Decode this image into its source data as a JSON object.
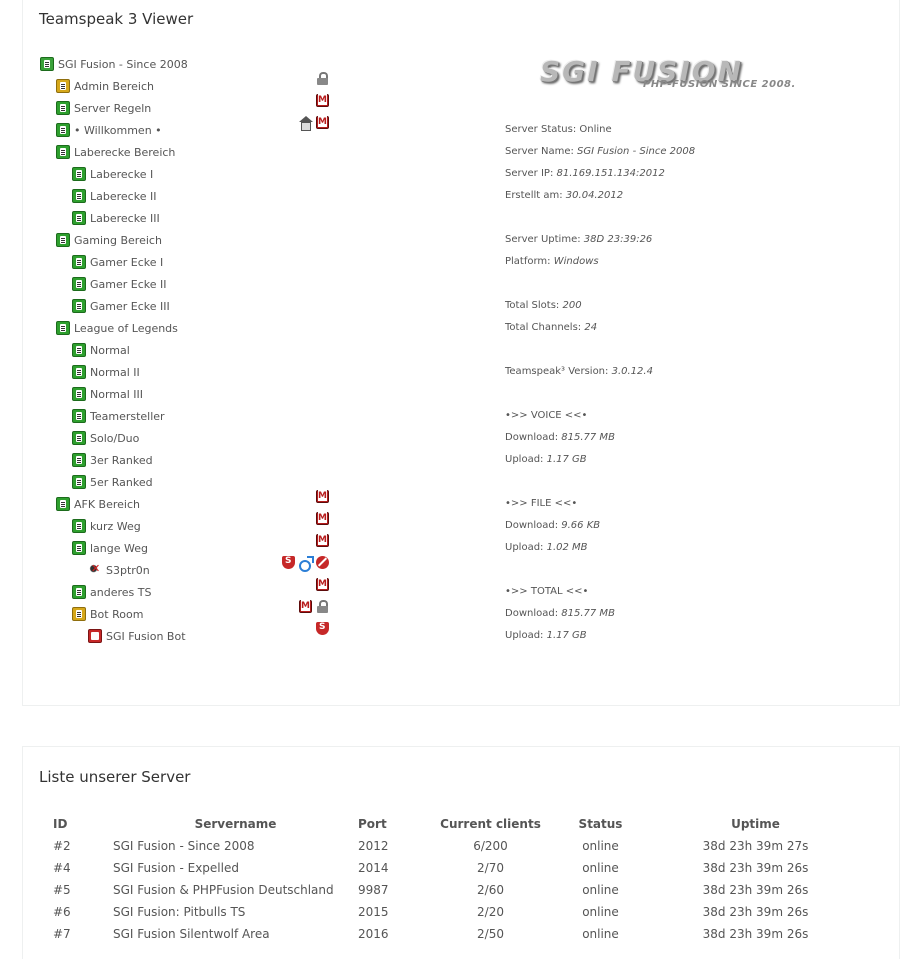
{
  "viewer": {
    "title": "Teamspeak 3 Viewer",
    "logo": {
      "main": "SGI FUSION",
      "sub": "PHP-FUSION SINCE 2008."
    },
    "tree": [
      {
        "label": "SGI Fusion - Since 2008",
        "type": "server",
        "depth": 0,
        "flags": []
      },
      {
        "label": "Admin Bereich",
        "type": "channel-locked",
        "depth": 1,
        "flags": [
          "lock"
        ]
      },
      {
        "label": "Server Regeln",
        "type": "channel",
        "depth": 1,
        "flags": [
          "moderated"
        ]
      },
      {
        "label": "• Willkommen •",
        "type": "channel",
        "depth": 1,
        "flags": [
          "home",
          "moderated"
        ]
      },
      {
        "label": "Laberecke Bereich",
        "type": "channel",
        "depth": 1,
        "flags": []
      },
      {
        "label": "Laberecke I",
        "type": "channel",
        "depth": 2,
        "flags": []
      },
      {
        "label": "Laberecke II",
        "type": "channel",
        "depth": 2,
        "flags": []
      },
      {
        "label": "Laberecke III",
        "type": "channel",
        "depth": 2,
        "flags": []
      },
      {
        "label": "Gaming Bereich",
        "type": "channel",
        "depth": 1,
        "flags": []
      },
      {
        "label": "Gamer Ecke I",
        "type": "channel",
        "depth": 2,
        "flags": []
      },
      {
        "label": "Gamer Ecke II",
        "type": "channel",
        "depth": 2,
        "flags": []
      },
      {
        "label": "Gamer Ecke III",
        "type": "channel",
        "depth": 2,
        "flags": []
      },
      {
        "label": "League of Legends",
        "type": "channel",
        "depth": 1,
        "flags": []
      },
      {
        "label": "Normal",
        "type": "channel",
        "depth": 2,
        "flags": []
      },
      {
        "label": "Normal II",
        "type": "channel",
        "depth": 2,
        "flags": []
      },
      {
        "label": "Normal III",
        "type": "channel",
        "depth": 2,
        "flags": []
      },
      {
        "label": "Teamersteller",
        "type": "channel",
        "depth": 2,
        "flags": []
      },
      {
        "label": "Solo/Duo",
        "type": "channel",
        "depth": 2,
        "flags": []
      },
      {
        "label": "3er Ranked",
        "type": "channel",
        "depth": 2,
        "flags": []
      },
      {
        "label": "5er Ranked",
        "type": "channel",
        "depth": 2,
        "flags": []
      },
      {
        "label": "AFK Bereich",
        "type": "channel",
        "depth": 1,
        "flags": [
          "moderated"
        ]
      },
      {
        "label": "kurz Weg",
        "type": "channel",
        "depth": 2,
        "flags": [
          "moderated"
        ]
      },
      {
        "label": "lange Weg",
        "type": "channel",
        "depth": 2,
        "flags": [
          "moderated"
        ]
      },
      {
        "label": "S3ptr0n",
        "type": "user-muted",
        "depth": 3,
        "flags": [
          "shield",
          "gender",
          "no-audio"
        ]
      },
      {
        "label": "anderes TS",
        "type": "channel",
        "depth": 2,
        "flags": [
          "moderated"
        ]
      },
      {
        "label": "Bot Room",
        "type": "channel-locked",
        "depth": 2,
        "flags": [
          "moderated",
          "lock"
        ]
      },
      {
        "label": "SGI Fusion Bot",
        "type": "user-bot",
        "depth": 3,
        "flags": [
          "shield"
        ]
      }
    ],
    "info": [
      {
        "row": 3,
        "label": "Server Status: Online",
        "value": ""
      },
      {
        "row": 4,
        "label": "Server Name: ",
        "value": "SGI Fusion - Since 2008"
      },
      {
        "row": 5,
        "label": "Server IP: ",
        "value": "81.169.151.134:2012"
      },
      {
        "row": 6,
        "label": "Erstellt am: ",
        "value": "30.04.2012"
      },
      {
        "row": 8,
        "label": "Server Uptime: ",
        "value": "38D 23:39:26"
      },
      {
        "row": 9,
        "label": "Platform: ",
        "value": "Windows"
      },
      {
        "row": 11,
        "label": "Total Slots: ",
        "value": "200"
      },
      {
        "row": 12,
        "label": "Total Channels: ",
        "value": "24"
      },
      {
        "row": 14,
        "label": "Teamspeak³ Version: ",
        "value": "3.0.12.4"
      },
      {
        "row": 16,
        "label": "•>> VOICE <<•",
        "value": ""
      },
      {
        "row": 17,
        "label": "Download: ",
        "value": "815.77 MB"
      },
      {
        "row": 18,
        "label": "Upload: ",
        "value": "1.17 GB"
      },
      {
        "row": 20,
        "label": "•>> FILE <<•",
        "value": ""
      },
      {
        "row": 21,
        "label": "Download: ",
        "value": "9.66 KB"
      },
      {
        "row": 22,
        "label": "Upload: ",
        "value": "1.02 MB"
      },
      {
        "row": 24,
        "label": "•>> TOTAL <<•",
        "value": ""
      },
      {
        "row": 25,
        "label": "Download: ",
        "value": "815.77 MB"
      },
      {
        "row": 26,
        "label": "Upload: ",
        "value": "1.17 GB"
      }
    ]
  },
  "servers": {
    "title": "Liste unserer Server",
    "columns": [
      "ID",
      "Servername",
      "Port",
      "Current clients",
      "Status",
      "Uptime"
    ],
    "rows": [
      [
        "#2",
        "SGI Fusion - Since 2008",
        "2012",
        "6/200",
        "online",
        "38d 23h 39m 27s"
      ],
      [
        "#4",
        "SGI Fusion - Expelled",
        "2014",
        "2/70",
        "online",
        "38d 23h 39m 26s"
      ],
      [
        "#5",
        "SGI Fusion & PHPFusion Deutschland",
        "9987",
        "2/60",
        "online",
        "38d 23h 39m 26s"
      ],
      [
        "#6",
        "SGI Fusion: Pitbulls TS",
        "2015",
        "2/20",
        "online",
        "38d 23h 39m 26s"
      ],
      [
        "#7",
        "SGI Fusion Silentwolf Area",
        "2016",
        "2/50",
        "online",
        "38d 23h 39m 26s"
      ]
    ]
  }
}
